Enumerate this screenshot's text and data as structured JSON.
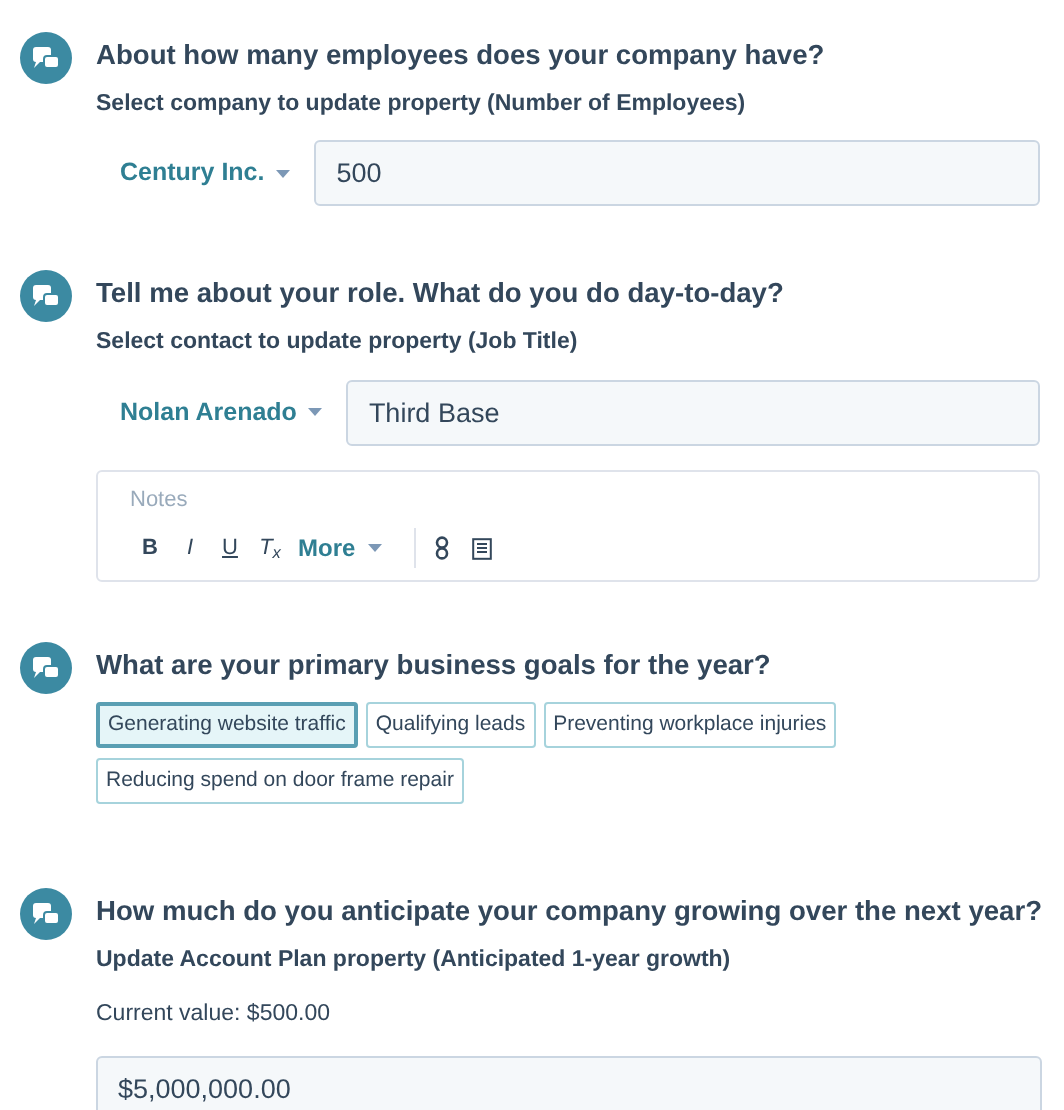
{
  "questions": [
    {
      "kind": "picker_field",
      "title": "About how many employees does your company have?",
      "subtitle": "Select company to update property (Number of Employees)",
      "picker": "Century Inc.",
      "value": "500"
    },
    {
      "kind": "picker_field",
      "title": "Tell me about your role. What do you do day-to-day?",
      "subtitle": "Select contact to update property (Job Title)",
      "picker": "Nolan Arenado",
      "value": "Third Base",
      "notes": {
        "placeholder": "Notes",
        "toolbar": [
          {
            "kind": "bold",
            "label": "B"
          },
          {
            "kind": "italic",
            "label": "I"
          },
          {
            "kind": "underline",
            "label": "U"
          },
          {
            "kind": "clear",
            "label": "T$_{x}$"
          },
          {
            "kind": "more",
            "label": "More"
          },
          {
            "kind": "link"
          },
          {
            "kind": "snippet"
          }
        ]
      }
    },
    {
      "kind": "tags",
      "title": "What are your primary business goals for the year?",
      "options": [
        {
          "label": "Generating website traffic",
          "selected": true
        },
        {
          "label": "Qualifying leads",
          "selected": false
        },
        {
          "label": "Preventing workplace injuries",
          "selected": false
        },
        {
          "label": "Reducing spend on door frame repair",
          "selected": false
        }
      ]
    },
    {
      "kind": "plain_field",
      "title": "How much do you anticipate your company growing over the next year?",
      "subtitle": "Update Account Plan property (Anticipated 1-year growth)",
      "current": "Current value: $500.00",
      "value": "$5,000,000.00"
    }
  ]
}
